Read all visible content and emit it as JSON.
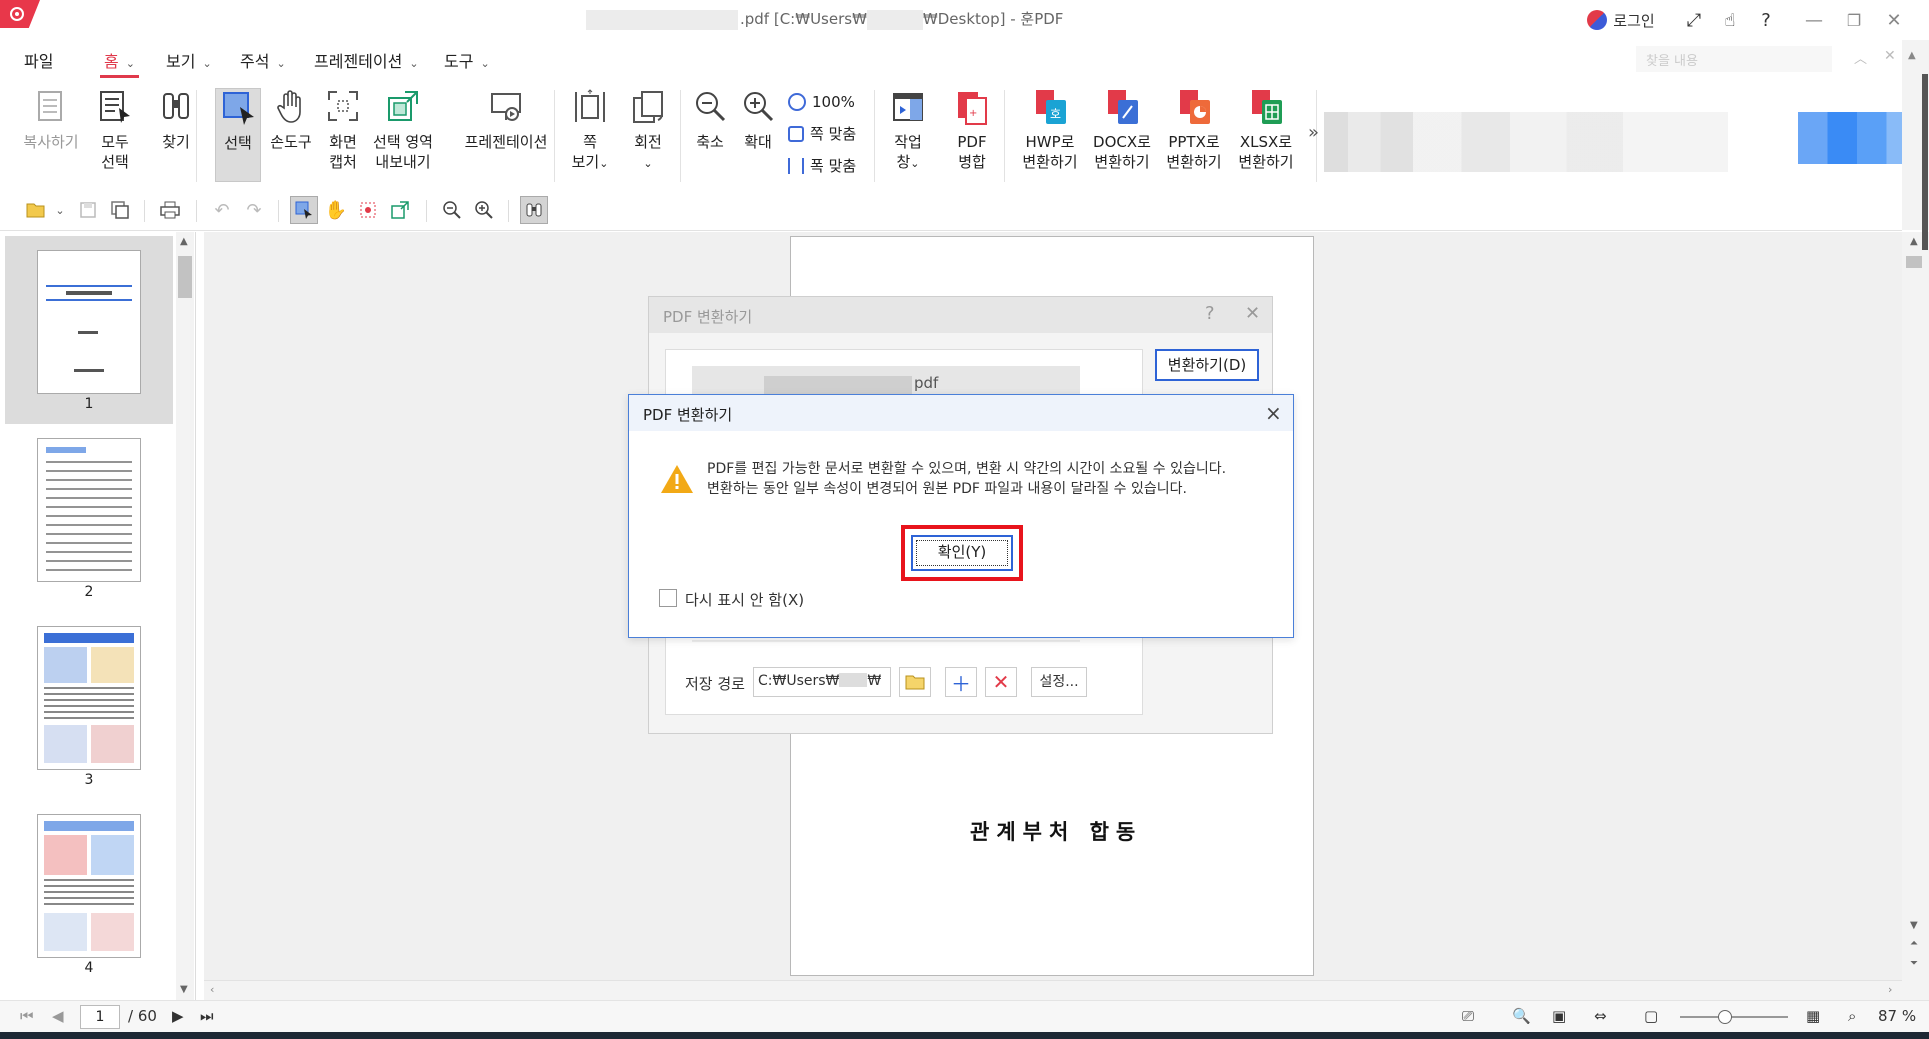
{
  "window": {
    "title_prefix": ".pdf [C:₩Users₩",
    "title_suffix": "₩Desktop] - 훈PDF",
    "login": "로그인",
    "help": "?"
  },
  "menu": {
    "tabs": [
      "파일",
      "홈",
      "보기",
      "주석",
      "프레젠테이션",
      "도구"
    ],
    "active": "홈",
    "search_placeholder": "찾을 내용"
  },
  "ribbon": {
    "copy": "복사하기",
    "select_all": [
      "모두",
      "선택"
    ],
    "find": "찾기",
    "select": "선택",
    "hand": "손도구",
    "screen_capture": [
      "화면",
      "캡처"
    ],
    "export_region": [
      "선택 영역",
      "내보내기"
    ],
    "presentation": "프레젠테이션",
    "page_view": [
      "쪽",
      "보기"
    ],
    "rotate": "회전",
    "zoom_out": "축소",
    "zoom_in": "확대",
    "zoom_100": "100%",
    "fit_page": "쪽 맞춤",
    "fit_width": "폭 맞춤",
    "task_pane": [
      "작업",
      "창"
    ],
    "pdf_merge": [
      "PDF",
      "병합"
    ],
    "to_hwp": [
      "HWP로",
      "변환하기"
    ],
    "to_docx": [
      "DOCX로",
      "변환하기"
    ],
    "to_pptx": [
      "PPTX로",
      "변환하기"
    ],
    "to_xlsx": [
      "XLSX로",
      "변환하기"
    ],
    "more": "»"
  },
  "thumbnails": {
    "pages": [
      "1",
      "2",
      "3",
      "4"
    ],
    "selected": "1"
  },
  "document": {
    "visible_text": "관계부처 합동"
  },
  "back_dialog": {
    "title": "PDF 변환하기",
    "file_suffix": "pdf",
    "convert_button": "변환하기(D)",
    "save_path_label": "저장 경로",
    "save_path_prefix": "C:₩Users₩",
    "save_path_suffix": "₩",
    "settings_button": "설정..."
  },
  "dialog": {
    "title": "PDF 변환하기",
    "message_line1": "PDF를 편집 가능한 문서로 변환할 수 있으며, 변환 시 약간의 시간이 소요될 수 있습니다.",
    "message_line2": "변환하는 동안 일부 속성이 변경되어 원본 PDF 파일과 내용이 달라질 수 있습니다.",
    "ok_button": "확인(Y)",
    "dont_show_label": "다시 표시 안 함(X)",
    "dont_show_checked": false
  },
  "status": {
    "current_page": "1",
    "total_pages": "/ 60",
    "zoom": "87 %"
  },
  "colors": {
    "brand": "#e0394b",
    "dialog_border": "#4a7fd8",
    "highlight": "#e8141c"
  }
}
